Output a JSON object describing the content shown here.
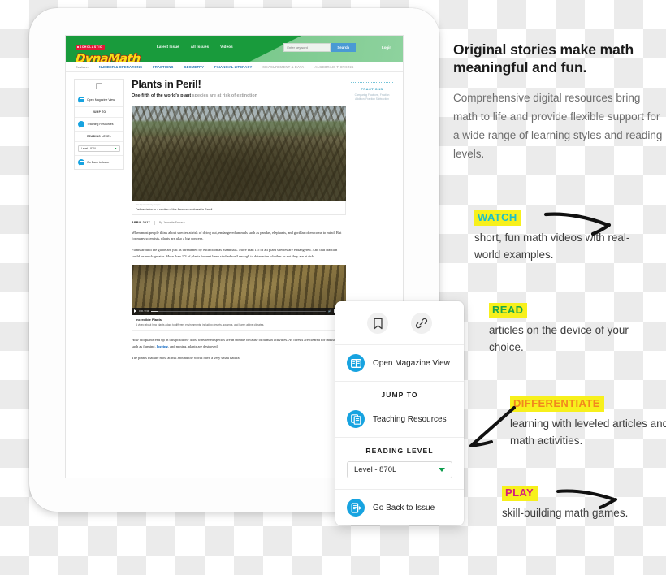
{
  "site": {
    "brand_tag": "SCHOLASTIC",
    "brand_name": "DynaMath",
    "nav": [
      "Latest Issue",
      "All Issues",
      "Videos"
    ],
    "search_placeholder": "Enter keyword",
    "search_button": "Search",
    "login": "Login",
    "subnav": {
      "explore_label": "Explore:",
      "items": [
        {
          "label": "NUMBER & OPERATIONS",
          "active": true
        },
        {
          "label": "FRACTIONS",
          "active": true
        },
        {
          "label": "GEOMETRY",
          "active": true
        },
        {
          "label": "FINANCIAL LITERACY",
          "active": true
        },
        {
          "label": "MEASUREMENT & DATA",
          "active": false
        },
        {
          "label": "ALGEBRAIC THINKING",
          "active": false
        }
      ]
    }
  },
  "mini_sidebar": {
    "open_magazine": "Open Magazine View",
    "jump_to": "JUMP TO",
    "teaching_resources": "Teaching Resources",
    "reading_level_label": "READING LEVEL",
    "reading_level_value": "Level - 870L",
    "go_back": "Go Back to Issue"
  },
  "article": {
    "title": "Plants in Peril!",
    "subhead_bold": "One-fifth of the world's plant",
    "subhead_rest": " species are at risk of extinction",
    "photo_credit": "Pal Agustino/Getty Images",
    "photo_caption": "Deforestation in a section of the Amazon rainforest in Brazil",
    "date": "APRIL 2017",
    "author": "By Jeanette Ferrara",
    "paragraph_1": "When most people think about species at risk of dying out, endangered animals such as pandas, elephants, and gorillas often come to mind. But for many scientists, plants are also a big concern.",
    "paragraph_2": "Plants around the globe are just as threatened by extinction as mammals. More than 1/5 of all plant species are endangered. And that fraction could be much greater. More than 1/3 of plants haven't been studied well enough to determine whether or not they are at risk.",
    "paragraph_3_pre": "How did plants end up in this position? Most threatened species are in trouble because of human activities. As forests are cleared for industries such as farming, ",
    "paragraph_3_link": "logging",
    "paragraph_3_post": ", and mining, plants are destroyed.",
    "paragraph_4": "The plants that are most at risk around the world have a very small natural",
    "video": {
      "time": "0:00 / 2:34",
      "title": "Incredible Plants",
      "description": "A video about how plants adapt to different environments, including deserts, swamps, and harsh alpine climates.",
      "cc_label": "CC"
    },
    "rail": {
      "title": "FRACTIONS",
      "body": "Comparing Fractions, Fraction Addition, Fraction Subtraction"
    }
  },
  "popup": {
    "bookmark_icon": "bookmark-icon",
    "link_icon": "link-icon",
    "open_magazine": "Open Magazine View",
    "jump_to": "JUMP TO",
    "teaching_resources": "Teaching Resources",
    "reading_level_label": "READING LEVEL",
    "reading_level_value": "Level - 870L",
    "go_back": "Go Back to Issue"
  },
  "marketing": {
    "headline": "Original stories make math meaningful and fun.",
    "subcopy": "Comprehensive digital resources bring math to life and provide flexible support for a wide range of learning styles and reading levels.",
    "annotations": [
      {
        "keyword": "WATCH",
        "keyword_color": "#1fbfc6",
        "highlight_color": "#f7f01c",
        "body": "short, fun math videos with real-world examples."
      },
      {
        "keyword": "READ",
        "keyword_color": "#1aa64b",
        "highlight_color": "#f7f01c",
        "body": "articles on the device of your choice."
      },
      {
        "keyword": "DIFFERENTIATE",
        "keyword_color": "#f2871e",
        "highlight_color": "#f7f01c",
        "body": "learning with leveled articles and math activities."
      },
      {
        "keyword": "PLAY",
        "keyword_color": "#d61a7e",
        "highlight_color": "#f7f01c",
        "body": "skill-building math games."
      }
    ]
  }
}
